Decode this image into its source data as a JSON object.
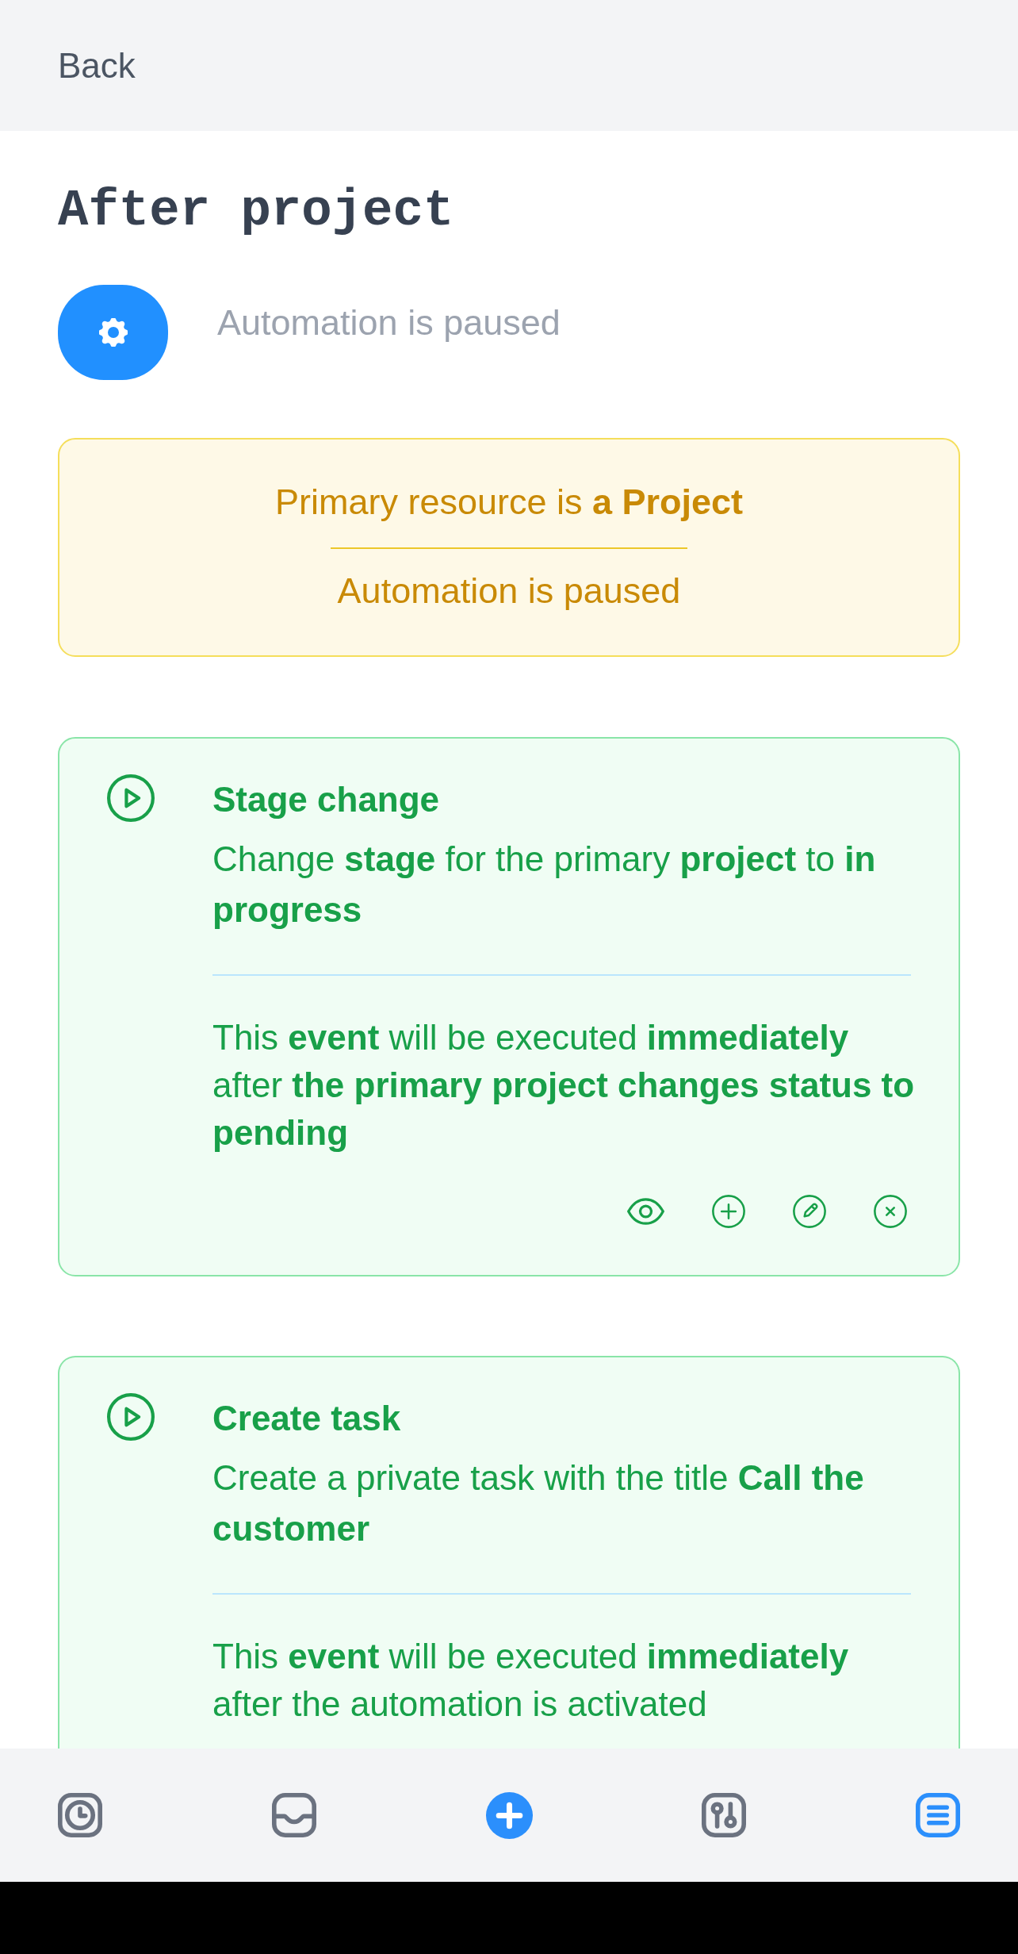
{
  "top_bar": {
    "back_label": "Back"
  },
  "page": {
    "title": "After project",
    "status_text": "Automation is paused"
  },
  "notice": {
    "lines": [
      "Primary resource is **a Project**",
      "Automation is paused"
    ]
  },
  "actions": [
    {
      "title": "Stage change",
      "description": "Change **stage** for the primary **project** to **in progress**",
      "timing": "This **event** will be executed **immediately** after **the primary project changes status to pending**",
      "controls_shown": true
    },
    {
      "title": "Create task",
      "description": "Create a private task with the title **Call the customer**",
      "timing": "This **event** will be executed **immediately** after the automation is activated",
      "controls_shown": false
    }
  ],
  "bottom_nav": {
    "items": [
      {
        "kind": "tab",
        "selected": false
      },
      {
        "kind": "tab",
        "selected": false
      },
      {
        "kind": "action"
      },
      {
        "kind": "tab",
        "selected": false
      },
      {
        "kind": "tab",
        "selected": true
      }
    ]
  }
}
